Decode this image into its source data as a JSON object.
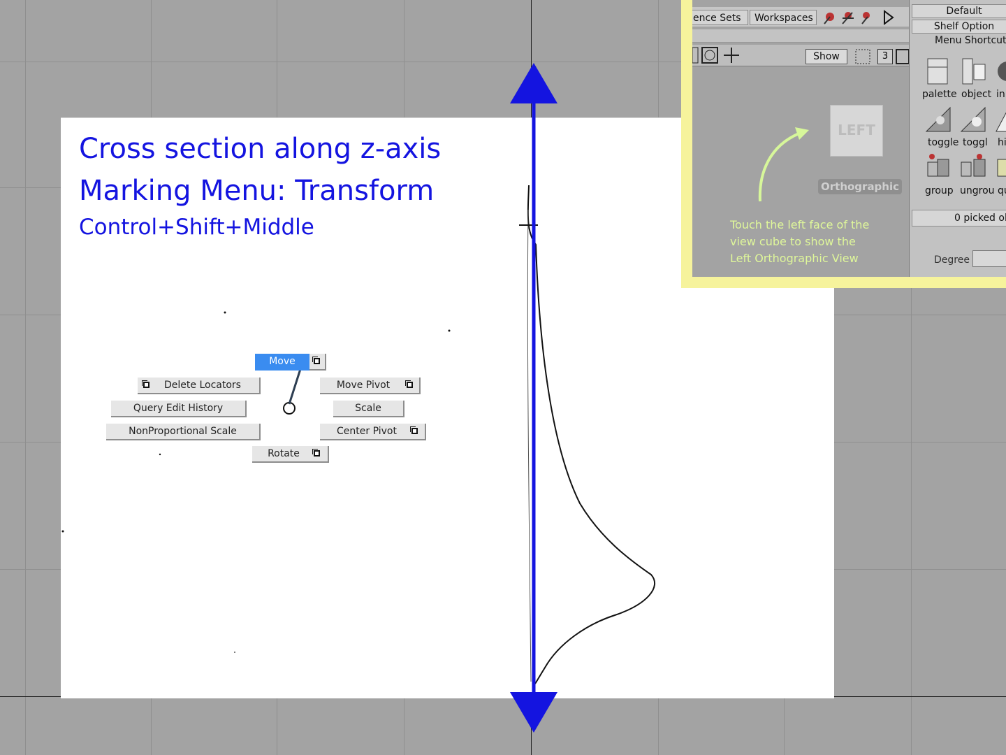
{
  "viewport": {
    "title": {
      "line1": "Cross section along z-axis",
      "line2": "Marking Menu: Transform",
      "line3": "Control+Shift+Middle"
    },
    "marking_menu": {
      "move": "Move",
      "delete_locators": "Delete Locators",
      "move_pivot": "Move Pivot",
      "query_edit_history": "Query Edit History",
      "scale": "Scale",
      "nonproportional_scale": "NonProportional Scale",
      "center_pivot": "Center Pivot",
      "rotate": "Rotate"
    },
    "colors": {
      "title": "#1414e0",
      "axis_arrow": "#1414e0",
      "highlight": "#3a8cf0",
      "background": "#a3a3a3"
    }
  },
  "inset": {
    "tabs": [
      "ence Sets",
      "Workspaces"
    ],
    "show_button": "Show",
    "number_box": "3",
    "viewcube_label": "LEFT",
    "ortho_label": "Orthographic",
    "hint_lines": [
      "Touch the left face of the",
      "view cube to show the",
      "Left Orthographic View"
    ],
    "side_panel": {
      "default_btn": "Default",
      "shelf_options": "Shelf Option",
      "menu_shortcuts": "Menu Shortcut:",
      "shelf_items_row1": [
        "palette",
        "object",
        "in"
      ],
      "shelf_items_row2": [
        "toggle",
        "toggl",
        "hi"
      ],
      "shelf_items_row3": [
        "group",
        "ungrou",
        "qu"
      ],
      "picked": "0 picked ob",
      "degree_label": "Degree"
    },
    "colors": {
      "frame": "#f6f39c",
      "hint_text": "#dff79a",
      "arrow": "#d7f79a"
    }
  }
}
